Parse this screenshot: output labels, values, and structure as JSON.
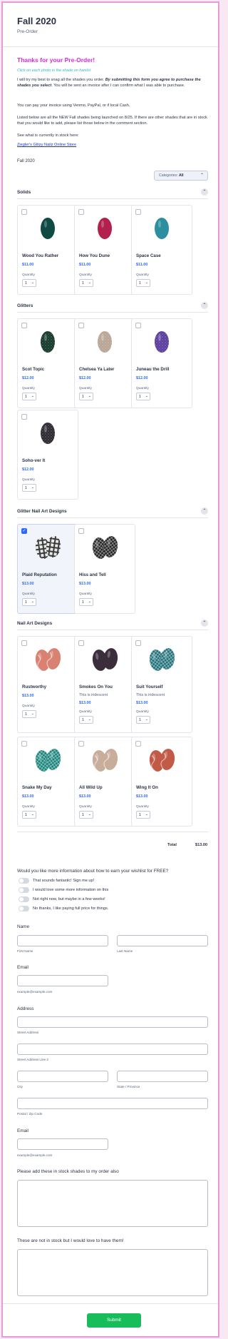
{
  "header": {
    "title": "Fall 2020",
    "subtitle": "Pre-Order"
  },
  "intro": {
    "thanks": "Thanks for your Pre-Order!",
    "click_hint": "Click on each photo in the shade on hands!",
    "p1_a": "I will try my best to snag all the shades you order. ",
    "p1_b": "By submitting this form you agree to purchase the shades you select",
    "p1_c": ". You will be sent an invoice after I can confirm what I was able to purchase.",
    "p2": "You can pay your invoice using Venmo, PayPal, or if local Cash.",
    "p3": "Listed below are all the NEW Fall shades being launched on 8/25. If there are other shades that are in stock that you would like to add, please list those below in the comment section.",
    "p4": "See what is currently in stock here:",
    "link": "Ziegler's Glitzy Nailz Online Store"
  },
  "products_label": "Fall 2020",
  "category_select": {
    "prefix": "Categories:",
    "value": "All",
    "caret": "⌃"
  },
  "quantity_label": "Quantity",
  "quantity_default": "1",
  "sections": [
    {
      "title": "Solids",
      "toggle": "⌃"
    },
    {
      "title": "Glitters",
      "toggle": "⌃"
    },
    {
      "title": "Glitter Nail Art Designs",
      "toggle": "⌃"
    },
    {
      "title": "Nail Art Designs",
      "toggle": "⌃"
    }
  ],
  "products": [
    {
      "name": "Wood You Rather",
      "price": "$11.00",
      "desc": "",
      "color": "#0f4a44",
      "checked": false
    },
    {
      "name": "How You Dune",
      "price": "$11.00",
      "desc": "",
      "color": "#b2204e",
      "checked": false
    },
    {
      "name": "Space Case",
      "price": "$11.00",
      "desc": "",
      "color": "#2c8fa0",
      "checked": false
    },
    {
      "name": "Scot Topic",
      "price": "$12.00",
      "desc": "",
      "color": "#163a2c",
      "checked": false
    },
    {
      "name": "Chelsea Ya Later",
      "price": "$12.00",
      "desc": "",
      "color": "#b9a594",
      "checked": false
    },
    {
      "name": "Juneau the Drill",
      "price": "$12.00",
      "desc": "",
      "color": "#5a3f9c",
      "checked": false
    },
    {
      "name": "Soho-ver It",
      "price": "$12.00",
      "desc": "",
      "color": "#2e2a33",
      "checked": false
    },
    {
      "name": "Plaid Reputation",
      "price": "$13.00",
      "desc": "",
      "color": "#3a3a3a",
      "checked": true
    },
    {
      "name": "Hiss and Tell",
      "price": "$13.00",
      "desc": "",
      "color": "#222222",
      "checked": false
    },
    {
      "name": "Rustworthy",
      "price": "$13.00",
      "desc": "",
      "color": "#d98271",
      "checked": false
    },
    {
      "name": "Smokes On You",
      "price": "$13.00",
      "desc": "This is iridescent",
      "color": "#3b2d3c",
      "checked": false
    },
    {
      "name": "Suit Yourself",
      "price": "$13.00",
      "desc": "This is iridescent",
      "color": "#1f6f78",
      "checked": false
    },
    {
      "name": "Snake My Day",
      "price": "$13.00",
      "desc": "",
      "color": "#17827a",
      "checked": false
    },
    {
      "name": "All Wild Up",
      "price": "$13.00",
      "desc": "",
      "color": "#c9ad9b",
      "checked": false
    },
    {
      "name": "Wing It On",
      "price": "$13.00",
      "desc": "",
      "color": "#c25a48",
      "checked": false
    }
  ],
  "total": {
    "label": "Total",
    "value": "$13.00"
  },
  "wishlist": {
    "question": "Would you like more information about how to earn your wishlist for FREE?",
    "options": [
      "That sounds fantastic! Sign me up!",
      "I would love some more information on this",
      "Not right now, but maybe in a few weeks!",
      "No thanks, I like paying full price for things."
    ]
  },
  "name_field": {
    "label": "Name",
    "first": "First Name",
    "last": "Last Name"
  },
  "email_field": {
    "label": "Email",
    "sub": "example@example.com"
  },
  "address_field": {
    "label": "Address",
    "street": "Street Address",
    "street2": "Street Address Line 2",
    "city": "City",
    "state": "State / Province",
    "zip": "Postal / Zip Code"
  },
  "email2_field": {
    "label": "Email",
    "sub": "example@example.com"
  },
  "instock_field": {
    "label": "Please add these in stock shades to my order also"
  },
  "notinstock_field": {
    "label": "These are not in stock but I would love to have them!"
  },
  "submit_label": "Submit"
}
